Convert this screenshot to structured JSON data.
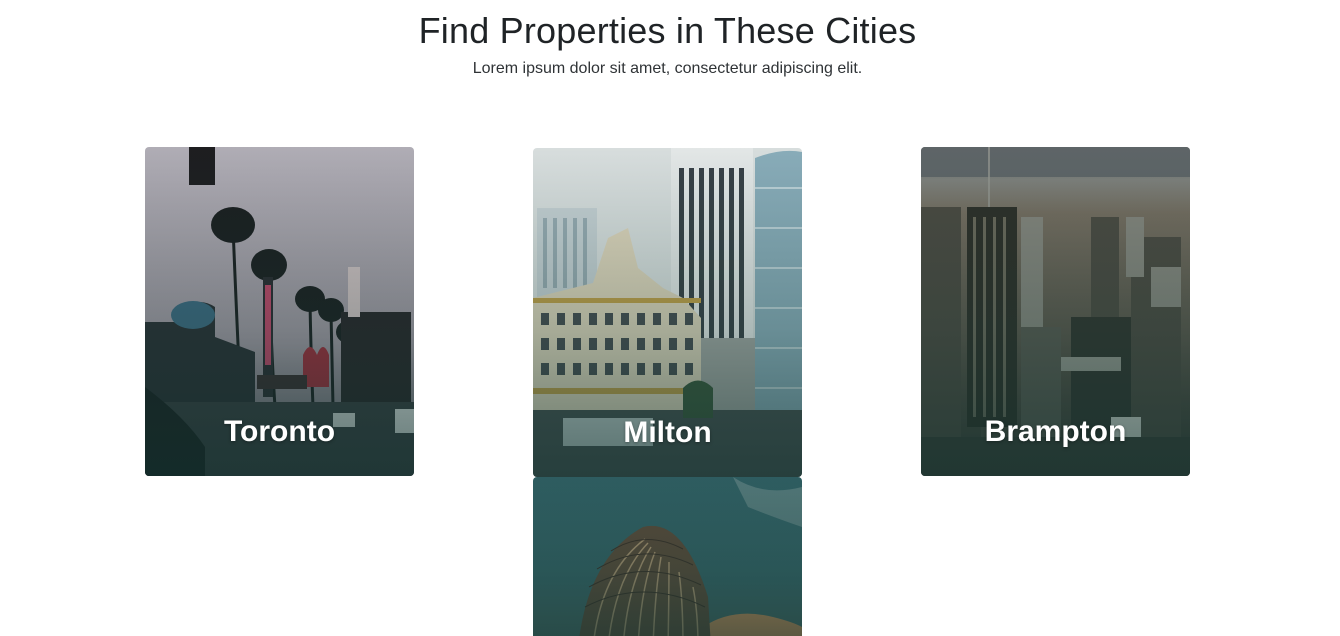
{
  "section": {
    "title": "Find Properties in These Cities",
    "subtitle": "Lorem ipsum dolor sit amet, consectetur adipiscing elit."
  },
  "cities": [
    {
      "name": "Toronto",
      "icon": "city-photo-palm-street"
    },
    {
      "name": "Milton",
      "icon": "city-photo-buildings"
    },
    {
      "name": "Brampton",
      "icon": "city-photo-aerial-skyline"
    },
    {
      "name": "",
      "icon": "city-photo-curved-tower"
    }
  ],
  "colors": {
    "overlay": "#1f4a44",
    "heading_text": "#1f2326",
    "card_text": "#ffffff"
  }
}
